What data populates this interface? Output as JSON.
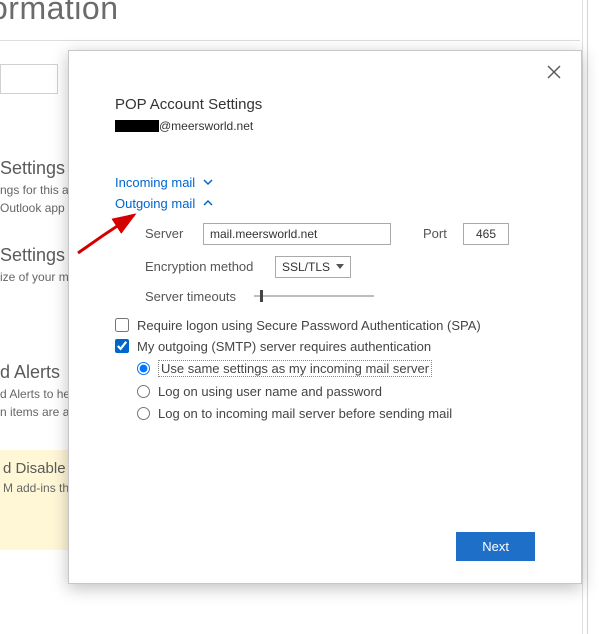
{
  "bg": {
    "title": "ormation",
    "sec1": {
      "h": "Settings",
      "line1": "ngs for this ac",
      "link": "Outlook app w"
    },
    "sec2": {
      "h": "Settings",
      "line1": "ize of your m"
    },
    "sec3": {
      "h": "d Alerts",
      "line1": "d Alerts to he",
      "line2": "n items are ad"
    },
    "sec4": {
      "h": "d Disable",
      "line1": "M add-ins tha"
    }
  },
  "dialog": {
    "title": "POP Account Settings",
    "email_domain": "@meersworld.net",
    "incoming_label": "Incoming mail",
    "outgoing_label": "Outgoing mail",
    "server_label": "Server",
    "server_value": "mail.meersworld.net",
    "port_label": "Port",
    "port_value": "465",
    "encryption_label": "Encryption method",
    "encryption_value": "SSL/TLS",
    "timeouts_label": "Server timeouts",
    "spa_label": "Require logon using Secure Password Authentication (SPA)",
    "smtp_auth_label": "My outgoing (SMTP) server requires authentication",
    "radio_same": "Use same settings as my incoming mail server",
    "radio_userpass": "Log on using user name and password",
    "radio_incoming_before": "Log on to incoming mail server before sending mail",
    "next_label": "Next"
  }
}
